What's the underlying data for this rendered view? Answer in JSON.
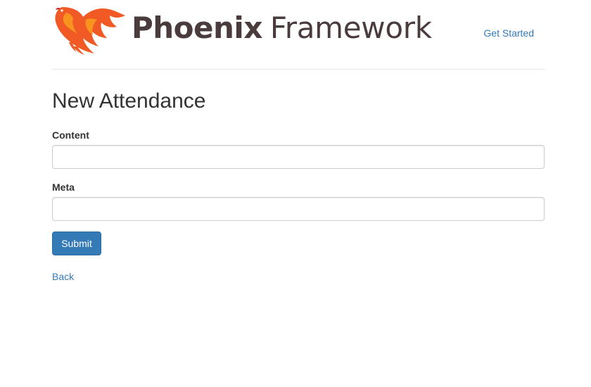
{
  "header": {
    "logo_text_strong": "Phoenix",
    "logo_text_light": "Framework",
    "logo_icon": "phoenix-bird-logo",
    "nav_link": "Get Started"
  },
  "main": {
    "title": "New Attendance",
    "fields": [
      {
        "label": "Content",
        "value": "",
        "placeholder": ""
      },
      {
        "label": "Meta",
        "value": "",
        "placeholder": ""
      }
    ],
    "submit_label": "Submit",
    "back_label": "Back"
  },
  "colors": {
    "link": "#337ab7",
    "button_bg": "#337ab7",
    "logo_orange": "#f15a24",
    "logo_text": "#4a3b3c"
  }
}
